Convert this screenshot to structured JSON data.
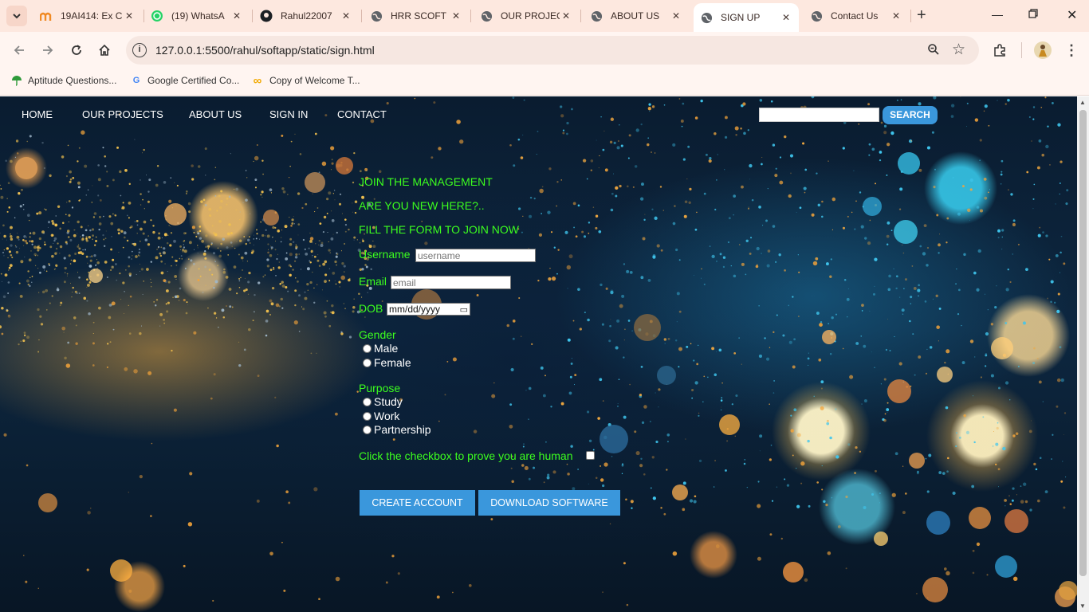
{
  "browser": {
    "tabs": [
      {
        "title": "19AI414: Ex C",
        "icon": "moodle-icon",
        "active": false
      },
      {
        "title": "(19) WhatsA",
        "icon": "whatsapp-icon",
        "active": false
      },
      {
        "title": "Rahul22007",
        "icon": "github-icon",
        "active": false
      },
      {
        "title": "HRR SCOFT",
        "icon": "globe-icon",
        "active": false
      },
      {
        "title": "OUR PROJEC",
        "icon": "globe-icon",
        "active": false
      },
      {
        "title": "ABOUT US",
        "icon": "globe-icon",
        "active": false
      },
      {
        "title": "SIGN UP",
        "icon": "globe-icon",
        "active": true
      },
      {
        "title": "Contact Us",
        "icon": "globe-icon",
        "active": false
      }
    ],
    "url": "127.0.0.1:5500/rahul/softapp/static/sign.html",
    "bookmarks": [
      {
        "label": "Aptitude Questions...",
        "icon": "umbrella-icon"
      },
      {
        "label": "Google Certified Co...",
        "icon": "google-icon"
      },
      {
        "label": "Copy of Welcome T...",
        "icon": "infinity-icon"
      }
    ]
  },
  "site": {
    "nav": [
      "HOME",
      "OUR PROJECTS",
      "ABOUT US",
      "SIGN IN",
      "CONTACT"
    ],
    "search_button": "SEARCH",
    "search_value": ""
  },
  "form": {
    "heading1": "JOIN THE MANAGEMENT",
    "heading2": "ARE YOU NEW HERE?..",
    "heading3": "FILL THE FORM TO JOIN NOW",
    "username_label": "Username",
    "username_placeholder": "username",
    "email_label": "Email",
    "email_placeholder": "email",
    "dob_label": "DOB",
    "dob_placeholder": "mm/dd/yyyy",
    "gender_label": "Gender",
    "gender_options": [
      "Male",
      "Female"
    ],
    "purpose_label": "Purpose",
    "purpose_options": [
      "Study",
      "Work",
      "Partnership"
    ],
    "human_check_label": "Click the checkbox to prove you are human",
    "create_button": "CREATE ACCOUNT",
    "download_button": "DOWNLOAD SOFTWARE"
  },
  "colors": {
    "form_text": "#3cff1e",
    "button": "#3a97dc",
    "tabstrip": "#fde8df"
  }
}
